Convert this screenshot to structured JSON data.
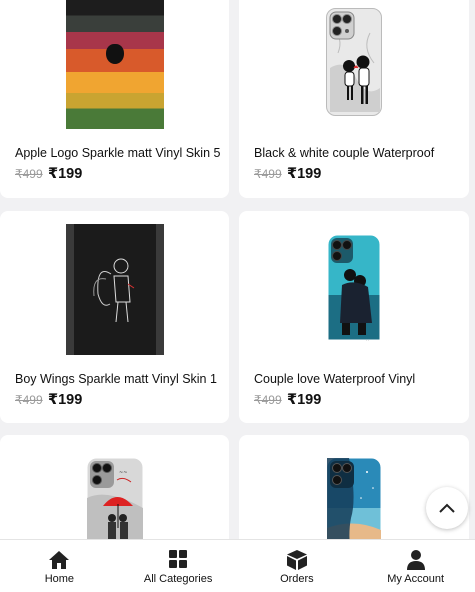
{
  "products": [
    {
      "title": "Apple Logo Sparkle matt Vinyl Skin 5",
      "old_price": "₹499",
      "price": "₹199",
      "art": "apple-logo-skin-image"
    },
    {
      "title": "Black & white couple Waterproof",
      "old_price": "₹499",
      "price": "₹199",
      "art": "bw-couple-phone-image"
    },
    {
      "title": "Boy Wings Sparkle matt Vinyl Skin 1",
      "old_price": "₹499",
      "price": "₹199",
      "art": "boy-wings-skin-image"
    },
    {
      "title": "Couple love Waterproof Vinyl",
      "old_price": "₹499",
      "price": "₹199",
      "art": "couple-love-phone-image"
    },
    {
      "art": "red-umbrella-couple-phone-image"
    },
    {
      "art": "sea-sky-phone-image"
    }
  ],
  "nav": {
    "home": "Home",
    "categories": "All Categories",
    "orders": "Orders",
    "account": "My Account"
  },
  "colors": {
    "background": "#f1f1f3",
    "card": "#ffffff",
    "strike": "#9a9a9a",
    "text": "#111111"
  },
  "icons": {
    "home": "home-icon",
    "categories": "grid-icon",
    "orders": "box-icon",
    "account": "user-icon",
    "scroll_top": "chevron-up-icon"
  }
}
